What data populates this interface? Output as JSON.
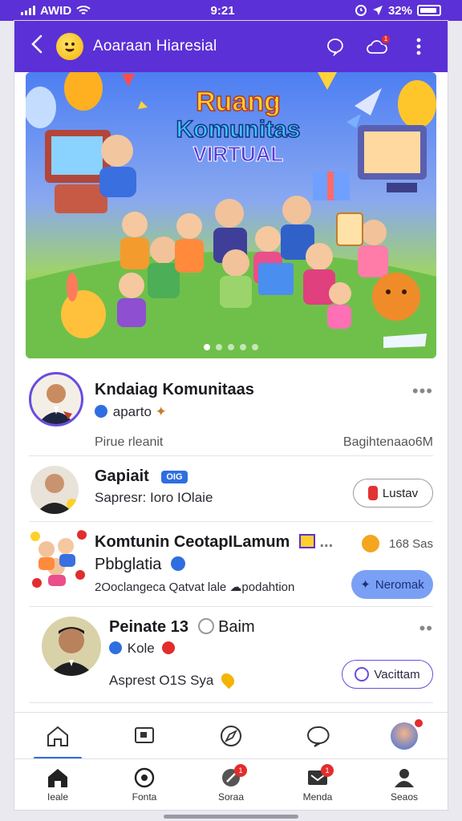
{
  "status_bar": {
    "carrier": "AWID",
    "time": "9:21",
    "battery": "32%"
  },
  "header": {
    "title": "Aoaraan Hiaresial"
  },
  "banner": {
    "line1": "Ruang",
    "line2": "Komunitas",
    "line3": "VIRTUAL"
  },
  "feed": [
    {
      "title": "Kndaiag Komunitaas",
      "handle": "aparto",
      "meta_left": "Pirue rleanit",
      "meta_right": "Bagihtenaao6M",
      "more": "•••"
    },
    {
      "title": "Gapiait",
      "tag": "OIG",
      "subtitle": "Sapresr: Ioro IOlaie",
      "button": "Lustav"
    },
    {
      "title": "Komtunin CeotapILamum",
      "title_suffix": "...",
      "line2": "Pbbglatia",
      "line3": "2Ooclangeca Qatvat lale ☁podahtion",
      "count": "168 Sas",
      "button": "Neromak"
    },
    {
      "title": "Peinate 13",
      "title_suffix": "Baim",
      "handle": "Kole",
      "subtitle": "Asprest O1S Sya",
      "button": "Vacittam",
      "more": "••"
    }
  ],
  "bottom_nav": [
    {
      "label": "Ieale",
      "icon": "home-icon"
    },
    {
      "label": "Fonta",
      "icon": "compass-icon"
    },
    {
      "label": "Soraa",
      "icon": "search-icon",
      "badge": "1"
    },
    {
      "label": "Menda",
      "icon": "mail-icon",
      "badge": "1"
    },
    {
      "label": "Seaos",
      "icon": "profile-icon"
    }
  ],
  "colors": {
    "primary": "#5b30d6",
    "accent": "#2f6ee0",
    "badge": "#e22d2d"
  }
}
